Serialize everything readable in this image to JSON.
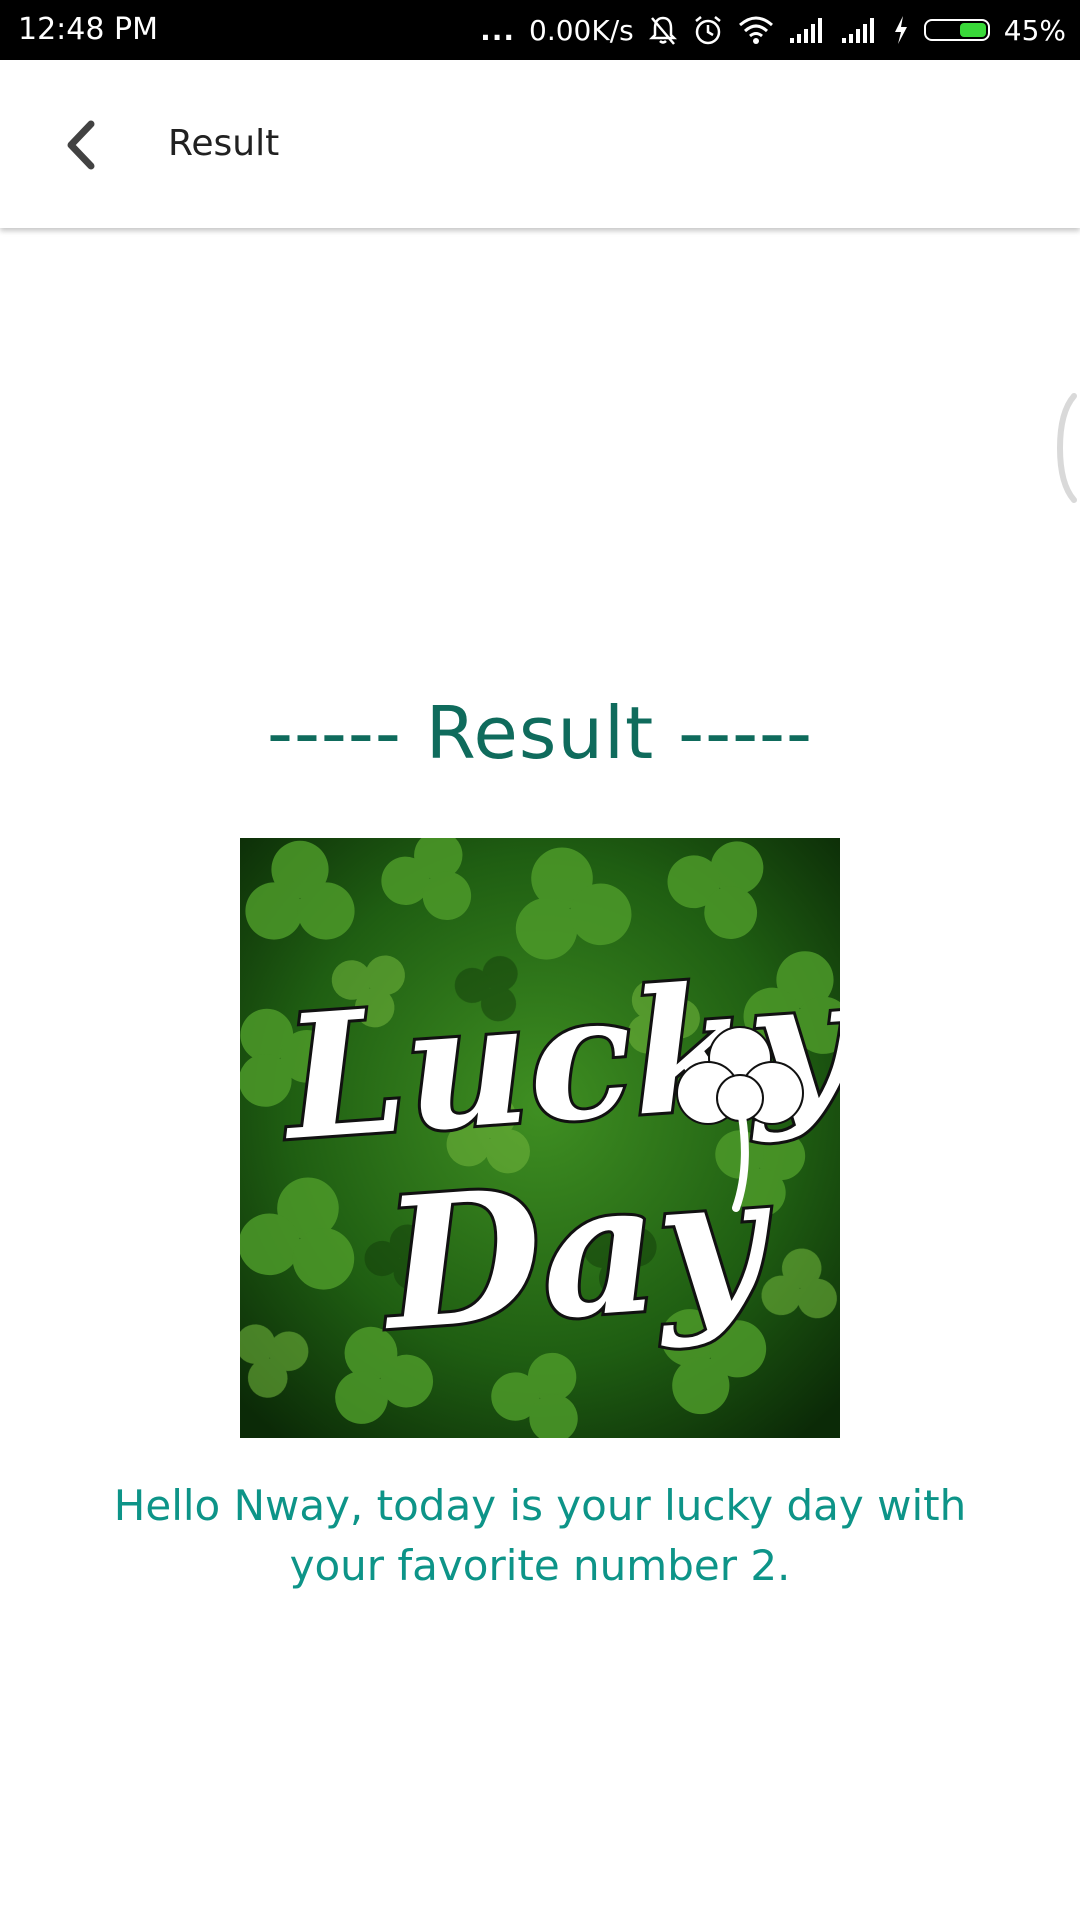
{
  "status_bar": {
    "time": "12:48 PM",
    "dots": "...",
    "network_speed": "0.00K/s",
    "battery_percent": "45%",
    "battery_level": 0.45,
    "icons": [
      "mute-bell-icon",
      "alarm-icon",
      "wifi-icon",
      "signal-icon",
      "signal-icon",
      "charging-icon",
      "battery-icon"
    ]
  },
  "app_bar": {
    "title": "Result",
    "back_icon": "chevron-left-icon"
  },
  "content": {
    "heading": "----- Result -----",
    "image": {
      "text_line1": "Lucky",
      "text_line2": "Day",
      "icon": "clover-icon"
    },
    "message": "Hello  Nway, today is your lucky day with your favorite number 2."
  },
  "colors": {
    "heading": "#0f6b5c",
    "message": "#0d9488",
    "battery_fill": "#3ad93a",
    "clover_green": "#2f7d1e"
  }
}
